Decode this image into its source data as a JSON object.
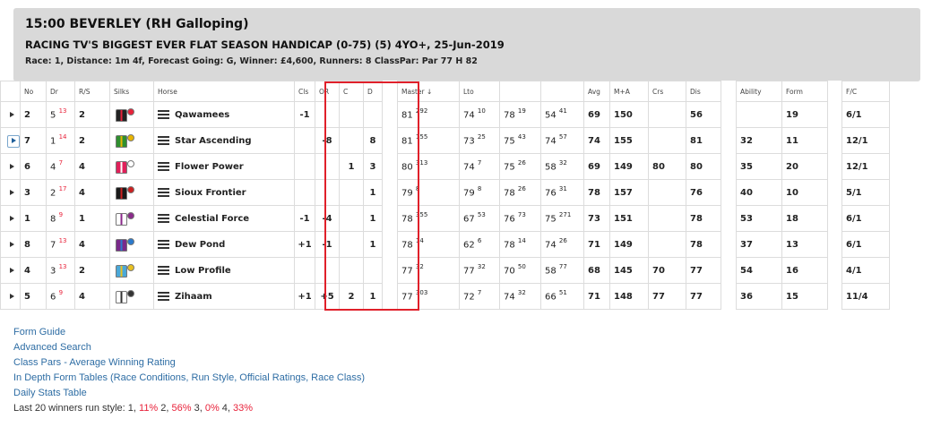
{
  "race": {
    "title": "15:00 BEVERLEY (RH Galloping)",
    "name": "RACING TV'S BIGGEST EVER FLAT SEASON HANDICAP (0-75) (5) 4YO+, 25-Jun-2019",
    "info": "Race: 1,  Distance: 1m 4f,  Forecast Going: G,  Winner: £4,600,  Runners: 8  ClassPar: Par 77 H 82"
  },
  "columns": [
    "No",
    "Dr",
    "R/S",
    "Silks",
    "Horse",
    "Cls",
    "OR",
    "C",
    "D",
    "Master ↓",
    "Lto",
    "",
    "",
    "Avg",
    "M+A",
    "Crs",
    "Dis",
    "Ability",
    "Form",
    "F/C"
  ],
  "colors": {
    "red": "#e8223a",
    "green": "#2b8a2b",
    "link": "#2e6da4",
    "highlight": "#e0202a"
  },
  "rows": [
    {
      "no": "2",
      "dr": "5",
      "dr_sup": "13",
      "rs": "2",
      "silk": [
        "#222222",
        "#e8223a"
      ],
      "horse": "Qawamees",
      "cls": "-1",
      "or": "",
      "c": "",
      "d": "",
      "master": "81",
      "master_sup": "292",
      "lto": "74",
      "lto_sup": "10",
      "r3": "78",
      "r3_sup": "19",
      "r4": "54",
      "r4_sup": "41",
      "avg": "69",
      "ma": "150",
      "crs": "",
      "dis": "56",
      "ability": "",
      "form": "19",
      "fc": "6/1",
      "sel": false
    },
    {
      "no": "7",
      "dr": "1",
      "dr_sup": "14",
      "rs": "2",
      "silk": [
        "#2f8f2f",
        "#e8b400"
      ],
      "horse": "Star Ascending",
      "cls": "",
      "or": "-8",
      "c": "",
      "d": "8",
      "master": "81",
      "master_sup": "155",
      "lto": "73",
      "lto_sup": "25",
      "r3": "75",
      "r3_sup": "43",
      "r4": "74",
      "r4_sup": "57",
      "avg": "74",
      "ma": "155",
      "crs": "",
      "dis": "81",
      "ability": "32",
      "form": "11",
      "fc": "12/1",
      "sel": true
    },
    {
      "no": "6",
      "dr": "4",
      "dr_sup": "7",
      "rs": "4",
      "silk": [
        "#e0205a",
        "#ffffff"
      ],
      "horse": "Flower Power",
      "cls": "",
      "or": "",
      "c": "1",
      "d": "3",
      "master": "80",
      "master_sup": "313",
      "lto": "74",
      "lto_sup": "7",
      "r3": "75",
      "r3_sup": "26",
      "r4": "58",
      "r4_sup": "32",
      "avg": "69",
      "ma": "149",
      "crs": "80",
      "dis": "80",
      "ability": "35",
      "form": "20",
      "fc": "12/1",
      "sel": false
    },
    {
      "no": "3",
      "dr": "2",
      "dr_sup": "17",
      "rs": "4",
      "silk": [
        "#1a1a1a",
        "#cc2020"
      ],
      "horse": "Sioux Frontier",
      "cls": "",
      "or": "",
      "c": "",
      "d": "1",
      "master": "79",
      "master_sup": "8",
      "lto": "79",
      "lto_sup": "8",
      "r3": "78",
      "r3_sup": "26",
      "r4": "76",
      "r4_sup": "31",
      "avg": "78",
      "ma": "157",
      "crs": "",
      "dis": "76",
      "ability": "40",
      "form": "10",
      "fc": "5/1",
      "sel": false
    },
    {
      "no": "1",
      "dr": "8",
      "dr_sup": "9",
      "rs": "1",
      "silk": [
        "#ffffff",
        "#8a2a8a"
      ],
      "horse": "Celestial Force",
      "cls": "-1",
      "or": "-4",
      "c": "",
      "d": "1",
      "master": "78",
      "master_sup": "355",
      "lto": "67",
      "lto_sup": "53",
      "r3": "76",
      "r3_sup": "73",
      "r4": "75",
      "r4_sup": "271",
      "avg": "73",
      "ma": "151",
      "crs": "",
      "dis": "78",
      "ability": "53",
      "form": "18",
      "fc": "6/1",
      "sel": false
    },
    {
      "no": "8",
      "dr": "7",
      "dr_sup": "13",
      "rs": "4",
      "silk": [
        "#7a2a8a",
        "#2a7acc"
      ],
      "horse": "Dew Pond",
      "cls": "+1",
      "or": "-1",
      "c": "",
      "d": "1",
      "master": "78",
      "master_sup": "14",
      "lto": "62",
      "lto_sup": "6",
      "r3": "78",
      "r3_sup": "14",
      "r4": "74",
      "r4_sup": "26",
      "avg": "71",
      "ma": "149",
      "crs": "",
      "dis": "78",
      "ability": "37",
      "form": "13",
      "fc": "6/1",
      "sel": false
    },
    {
      "no": "4",
      "dr": "3",
      "dr_sup": "13",
      "rs": "2",
      "silk": [
        "#4aa8d8",
        "#e8c020"
      ],
      "horse": "Low Profile",
      "cls": "",
      "or": "",
      "c": "",
      "d": "",
      "master": "77",
      "master_sup": "32",
      "lto": "77",
      "lto_sup": "32",
      "r3": "70",
      "r3_sup": "50",
      "r4": "58",
      "r4_sup": "77",
      "avg": "68",
      "ma": "145",
      "crs": "70",
      "dis": "77",
      "ability": "54",
      "form": "16",
      "fc": "4/1",
      "sel": false
    },
    {
      "no": "5",
      "dr": "6",
      "dr_sup": "9",
      "rs": "4",
      "silk": [
        "#ffffff",
        "#333333"
      ],
      "horse": "Zihaam",
      "cls": "+1",
      "or": "+5",
      "c": "2",
      "d": "1",
      "master": "77",
      "master_sup": "303",
      "lto": "72",
      "lto_sup": "7",
      "r3": "74",
      "r3_sup": "32",
      "r4": "66",
      "r4_sup": "51",
      "avg": "71",
      "ma": "148",
      "crs": "77",
      "dis": "77",
      "ability": "36",
      "form": "15",
      "fc": "11/4",
      "sel": false
    }
  ],
  "red_fields": {
    "0": [
      "master",
      "lto"
    ],
    "1": [
      "master",
      "avg",
      "ma",
      "dis",
      "form"
    ],
    "2": [
      "master",
      "lto",
      "crs",
      "dis"
    ],
    "3": [
      "master",
      "lto",
      "avg",
      "ma",
      "ability",
      "form"
    ],
    "4": [
      "avg",
      "ma",
      "dis",
      "ability"
    ],
    "5": [
      "dis",
      "form"
    ],
    "6": [
      "lto",
      "ability",
      "crs"
    ],
    "7": [
      "crs"
    ]
  },
  "links": [
    "Form Guide",
    "Advanced Search",
    "Class Pars - Average Winning Rating",
    "In Depth Form Tables (Race Conditions, Run Style, Official Ratings, Race Class)",
    "Daily Stats Table"
  ],
  "run_style": {
    "prefix": "Last 20 winners run style: 1, ",
    "p1": "11%",
    "mid1": " 2, ",
    "p2": "56%",
    "mid2": " 3, ",
    "p3": "0%",
    "mid3": " 4, ",
    "p4": "33%"
  }
}
